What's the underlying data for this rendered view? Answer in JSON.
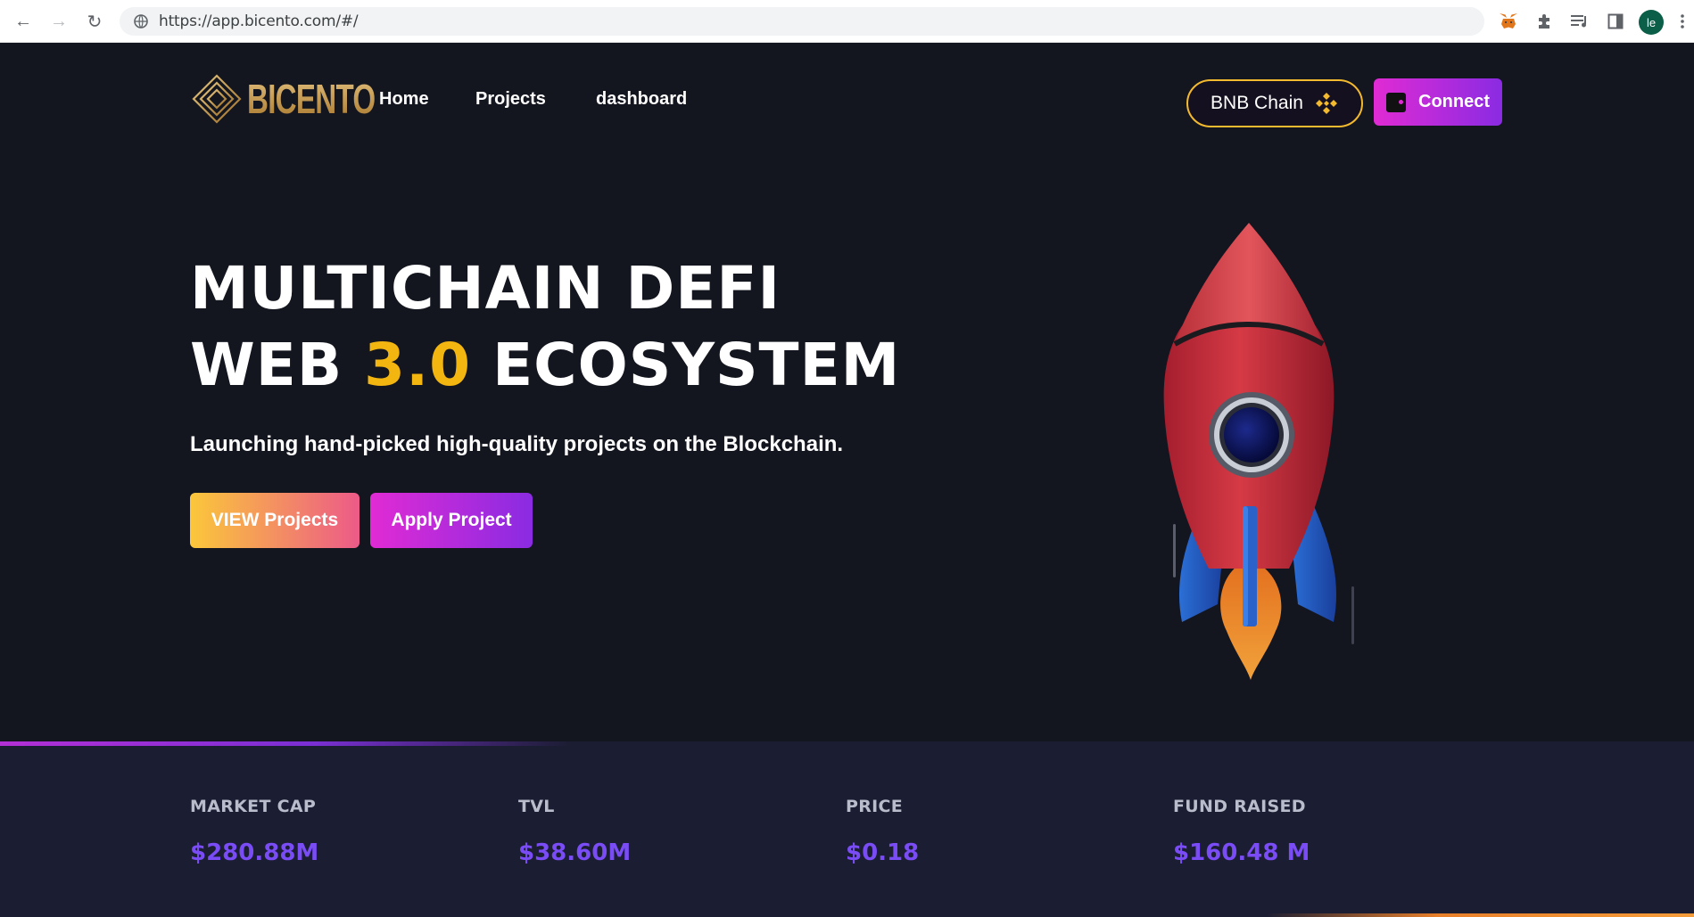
{
  "browser": {
    "url": "https://app.bicento.com/#/",
    "profile_initials": "le",
    "extensions": [
      "metamask-fox-icon",
      "puzzle-icon",
      "media-queue-icon",
      "side-panel-icon"
    ]
  },
  "header": {
    "logo_text": "BICENTO",
    "nav": [
      {
        "label": "Home"
      },
      {
        "label": "Projects"
      },
      {
        "label": "dashboard"
      }
    ],
    "chain_button": "BNB Chain",
    "connect_button": "Connect",
    "chain_color": "#f3ba2f"
  },
  "hero": {
    "line1": "MULTICHAIN DEFI",
    "line2_pre": "WEB ",
    "line2_accent": "3.0",
    "line2_post": " ECOSYSTEM",
    "subtitle": "Launching hand-picked high-quality projects on the Blockchain.",
    "primary_button": "VIEW Projects",
    "secondary_button": "Apply Project",
    "accent_color": "#f3b510"
  },
  "stats": [
    {
      "label": "MARKET CAP",
      "value": "$280.88M"
    },
    {
      "label": "TVL",
      "value": "$38.60M"
    },
    {
      "label": "PRICE",
      "value": "$0.18"
    },
    {
      "label": "FUND RAISED",
      "value": "$160.48 M"
    }
  ]
}
